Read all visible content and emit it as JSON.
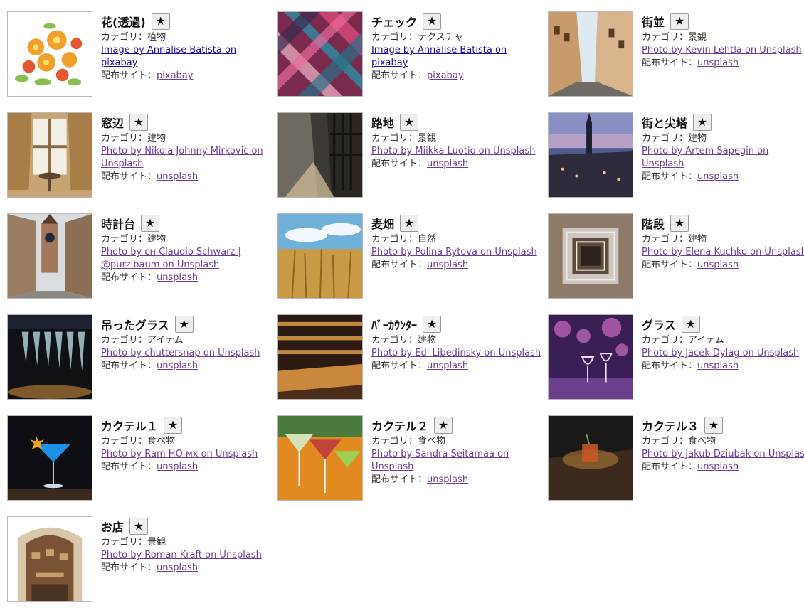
{
  "labels": {
    "category_prefix": "カテゴリ：",
    "site_prefix": "配布サイト：",
    "star": "★"
  },
  "items": [
    {
      "title": "花(透過)",
      "category": "植物",
      "credit": "Image by Annalise Batista on pixabay",
      "site": "pixabay",
      "link_color": "blue",
      "thumb": "flowers"
    },
    {
      "title": "チェック",
      "category": "テクスチャ",
      "credit": "Image by Annalise Batista on pixabay",
      "site": "pixabay",
      "link_color": "blue",
      "thumb": "plaid"
    },
    {
      "title": "街並",
      "category": "景観",
      "credit": "Photo by Kevin Lehtla on Unsplash",
      "site": "unsplash",
      "link_color": "purple",
      "thumb": "street"
    },
    {
      "title": "窓辺",
      "category": "建物",
      "credit": "Photo by Nikola Johnny Mirkovic on Unsplash",
      "site": "unsplash",
      "link_color": "purple",
      "thumb": "window"
    },
    {
      "title": "路地",
      "category": "景観",
      "credit": "Photo by Miikka Luotio on Unsplash",
      "site": "unsplash",
      "link_color": "purple",
      "thumb": "alley"
    },
    {
      "title": "街と尖塔",
      "category": "建物",
      "credit": "Photo by Artem Sapegin on Unsplash",
      "site": "unsplash",
      "link_color": "purple",
      "thumb": "spire"
    },
    {
      "title": "時計台",
      "category": "建物",
      "credit": "Photo by ᴄʜ Claudio Schwarz | @purzlbaum on Unsplash",
      "site": "unsplash",
      "link_color": "purple",
      "thumb": "clocktower"
    },
    {
      "title": "麦畑",
      "category": "自然",
      "credit": "Photo by Polina Rytova on Unsplash",
      "site": "unsplash",
      "link_color": "purple",
      "thumb": "wheat"
    },
    {
      "title": "階段",
      "category": "建物",
      "credit": "Photo by Elena Kuchko on Unsplash",
      "site": "unsplash",
      "link_color": "purple",
      "thumb": "stairs"
    },
    {
      "title": "吊ったグラス",
      "category": "アイテム",
      "credit": "Photo by chuttersnap on Unsplash",
      "site": "unsplash",
      "link_color": "purple",
      "thumb": "hanging-glasses"
    },
    {
      "title": "ﾊﾞｰｶｳﾝﾀｰ",
      "category": "建物",
      "credit": "Photo by Edi Libedinsky on Unsplash",
      "site": "unsplash",
      "link_color": "purple",
      "thumb": "bar"
    },
    {
      "title": "グラス",
      "category": "アイテム",
      "credit": "Photo by Jacek Dylag on Unsplash",
      "site": "unsplash",
      "link_color": "purple",
      "thumb": "glasses"
    },
    {
      "title": "カクテル１",
      "category": "食べ物",
      "credit": "Photo by Ram HO ᴍx on Unsplash",
      "site": "unsplash",
      "link_color": "purple",
      "thumb": "cocktail1"
    },
    {
      "title": "カクテル２",
      "category": "食べ物",
      "credit": "Photo by Sandra Seitamaa on Unsplash",
      "site": "unsplash",
      "link_color": "purple",
      "thumb": "cocktail2"
    },
    {
      "title": "カクテル３",
      "category": "食べ物",
      "credit": "Photo by Jakub Dziubak on Unsplash",
      "site": "unsplash",
      "link_color": "purple",
      "thumb": "cocktail3"
    },
    {
      "title": "お店",
      "category": "景観",
      "credit": "Photo by Roman Kraft on Unsplash",
      "site": "unsplash",
      "link_color": "purple",
      "thumb": "shop"
    }
  ]
}
